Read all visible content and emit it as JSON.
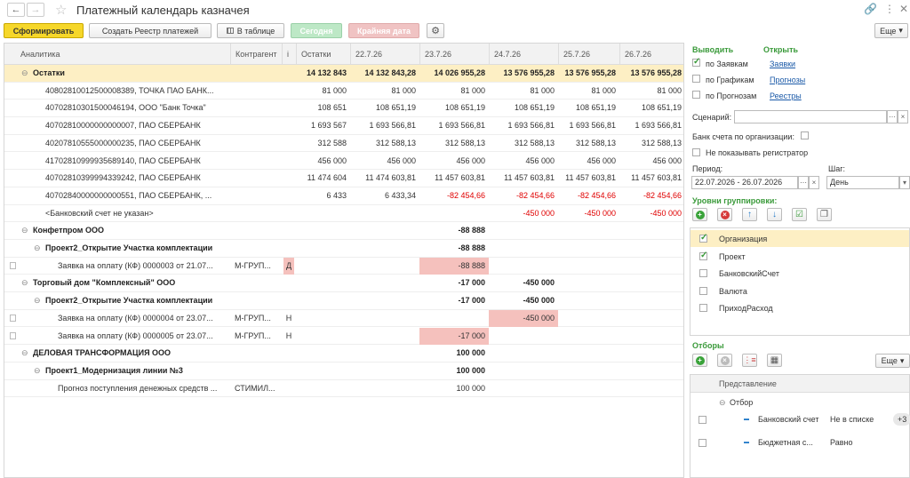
{
  "window": {
    "title": "Платежный календарь казначея",
    "back_icon": "arrow-left-icon",
    "forward_icon": "arrow-right-icon",
    "favorite_icon": "star-icon"
  },
  "toolbar": {
    "form_label": "Сформировать",
    "create_registry_label": "Создать Реестр платежей",
    "in_table_label": "В таблице",
    "today_label": "Сегодня",
    "deadline_label": "Крайняя дата",
    "more_label": "Еще"
  },
  "grid": {
    "headers": [
      "Аналитика",
      "Контрагент",
      "i",
      "Остатки",
      "22.7.26",
      "23.7.26",
      "24.7.26",
      "25.7.26",
      "26.7.26"
    ],
    "rows": [
      {
        "kind": "ost",
        "label": "Остатки",
        "kontr": "",
        "i": "",
        "v": [
          "14 132 843",
          "14 132 843,28",
          "14 026 955,28",
          "13 576 955,28",
          "13 576 955,28",
          "13 576 955,28"
        ]
      },
      {
        "kind": "acct",
        "label": "40802810012500008389, ТОЧКА ПАО БАНК...",
        "kontr": "",
        "i": "",
        "v": [
          "81 000",
          "81 000",
          "81 000",
          "81 000",
          "81 000",
          "81 000"
        ]
      },
      {
        "kind": "acct",
        "label": "40702810301500046194, ООО \"Банк Точка\"",
        "kontr": "",
        "i": "",
        "v": [
          "108 651",
          "108 651,19",
          "108 651,19",
          "108 651,19",
          "108 651,19",
          "108 651,19"
        ]
      },
      {
        "kind": "acct",
        "label": "40702810000000000007, ПАО СБЕРБАНК",
        "kontr": "",
        "i": "",
        "v": [
          "1 693 567",
          "1 693 566,81",
          "1 693 566,81",
          "1 693 566,81",
          "1 693 566,81",
          "1 693 566,81"
        ]
      },
      {
        "kind": "acct",
        "label": "40207810555000000235, ПАО СБЕРБАНК",
        "kontr": "",
        "i": "",
        "v": [
          "312 588",
          "312 588,13",
          "312 588,13",
          "312 588,13",
          "312 588,13",
          "312 588,13"
        ]
      },
      {
        "kind": "acct",
        "label": "41702810999935689140, ПАО СБЕРБАНК",
        "kontr": "",
        "i": "",
        "v": [
          "456 000",
          "456 000",
          "456 000",
          "456 000",
          "456 000",
          "456 000"
        ]
      },
      {
        "kind": "acct",
        "label": "40702810399994339242, ПАО СБЕРБАНК",
        "kontr": "",
        "i": "",
        "v": [
          "11 474 604",
          "11 474 603,81",
          "11 457 603,81",
          "11 457 603,81",
          "11 457 603,81",
          "11 457 603,81"
        ]
      },
      {
        "kind": "acct",
        "label": "40702840000000000551, ПАО СБЕРБАНК, ...",
        "kontr": "",
        "i": "",
        "v": [
          "6 433",
          "6 433,34",
          "-82 454,66",
          "-82 454,66",
          "-82 454,66",
          "-82 454,66"
        ]
      },
      {
        "kind": "acct",
        "label": "<Банковский счет не указан>",
        "kontr": "",
        "i": "",
        "v": [
          "",
          "",
          "",
          "-450 000",
          "-450 000",
          "-450 000"
        ]
      },
      {
        "kind": "org",
        "label": "Конфетпром ООО",
        "kontr": "",
        "i": "",
        "v": [
          "",
          "",
          "-88 888",
          "",
          "",
          ""
        ]
      },
      {
        "kind": "proj",
        "label": "Проект2_Открытие Участка комплектации",
        "kontr": "",
        "i": "",
        "v": [
          "",
          "",
          "-88 888",
          "",
          "",
          ""
        ]
      },
      {
        "kind": "doc",
        "label": "Заявка на оплату (КФ) 0000003 от 21.07...",
        "kontr": "М-ГРУП...",
        "i": "Д",
        "v": [
          "",
          "",
          "-88 888",
          "",
          "",
          ""
        ],
        "pink": [
          2
        ],
        "ipink": true
      },
      {
        "kind": "org",
        "label": "Торговый дом \"Комплексный\" ООО",
        "kontr": "",
        "i": "",
        "v": [
          "",
          "",
          "-17 000",
          "-450 000",
          "",
          ""
        ]
      },
      {
        "kind": "proj",
        "label": "Проект2_Открытие Участка комплектации",
        "kontr": "",
        "i": "",
        "v": [
          "",
          "",
          "-17 000",
          "-450 000",
          "",
          ""
        ]
      },
      {
        "kind": "doc",
        "label": "Заявка на оплату (КФ) 0000004 от 23.07...",
        "kontr": "М-ГРУП...",
        "i": "Н",
        "v": [
          "",
          "",
          "",
          "-450 000",
          "",
          ""
        ],
        "pink": [
          3
        ]
      },
      {
        "kind": "doc",
        "label": "Заявка на оплату (КФ) 0000005 от 23.07...",
        "kontr": "М-ГРУП...",
        "i": "Н",
        "v": [
          "",
          "",
          "-17 000",
          "",
          "",
          ""
        ],
        "pink": [
          2
        ]
      },
      {
        "kind": "org",
        "label": "ДЕЛОВАЯ ТРАНСФОРМАЦИЯ ООО",
        "kontr": "",
        "i": "",
        "v": [
          "",
          "",
          "100 000",
          "",
          "",
          ""
        ]
      },
      {
        "kind": "proj",
        "label": "Проект1_Модернизация линии №3",
        "kontr": "",
        "i": "",
        "v": [
          "",
          "",
          "100 000",
          "",
          "",
          ""
        ]
      },
      {
        "kind": "fdoc",
        "label": "Прогноз поступления денежных средств ...",
        "kontr": "СТИМИЛ...",
        "i": "",
        "v": [
          "",
          "",
          "100 000",
          "",
          "",
          ""
        ]
      }
    ]
  },
  "panel": {
    "show_title": "Выводить",
    "show_items": [
      {
        "label": "по Заявкам",
        "checked": true
      },
      {
        "label": "по Графикам",
        "checked": false
      },
      {
        "label": "по Прогнозам",
        "checked": false
      }
    ],
    "open_title": "Открыть",
    "open_links": [
      "Заявки",
      "Прогнозы",
      "Реестры"
    ],
    "scenario_label": "Сценарий:",
    "scenario_value": "",
    "bank_by_org_label": "Банк счета по организации:",
    "hide_registrator_label": "Не показывать регистратор",
    "period_label": "Период:",
    "period_value": "22.07.2026 - 26.07.2026",
    "step_label": "Шаг:",
    "step_value": "День",
    "levels_title": "Уровни группировки:",
    "levels": [
      {
        "label": "Организация",
        "checked": true,
        "selected": true
      },
      {
        "label": "Проект",
        "checked": true,
        "selected": false
      },
      {
        "label": "БанковскийСчет",
        "checked": false,
        "selected": false
      },
      {
        "label": "Валюта",
        "checked": false,
        "selected": false
      },
      {
        "label": "ПриходРасход",
        "checked": false,
        "selected": false
      }
    ],
    "filters_title": "Отборы",
    "filters_more": "Еще",
    "filters_header": "Представление",
    "filters_group": "Отбор",
    "filters": [
      {
        "name": "Банковский счет",
        "cond": "Не в списке",
        "extra": "+3"
      },
      {
        "name": "Бюджетная с...",
        "cond": "Равно",
        "extra": ""
      }
    ]
  }
}
